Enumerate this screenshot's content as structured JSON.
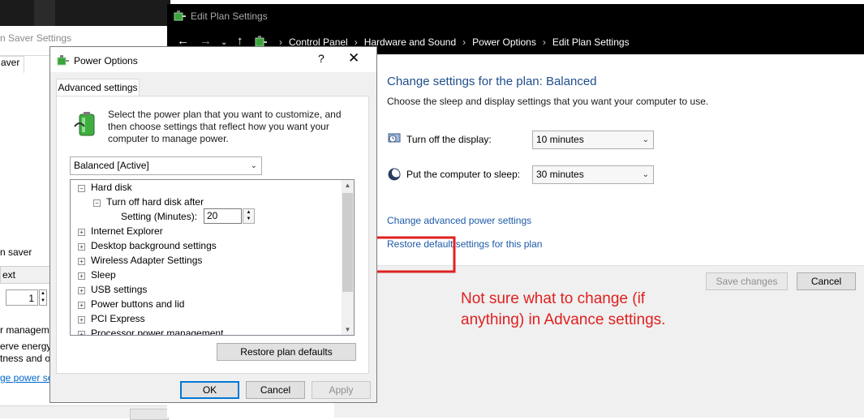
{
  "screen_saver_window": {
    "title_partial": "n Saver Settings",
    "tab_partial": "aver",
    "saver_label_partial": "n saver",
    "text_option_partial": "ext",
    "wait_value": "1",
    "power_mgmt_partial": "r managem",
    "desc_line1_partial": "erve energy",
    "desc_line2_partial": "tness and o",
    "link_partial": "ge power se"
  },
  "edit_plan": {
    "title": "Edit Plan Settings",
    "breadcrumbs": [
      "Control Panel",
      "Hardware and Sound",
      "Power Options",
      "Edit Plan Settings"
    ],
    "heading": "Change settings for the plan: Balanced",
    "subheading": "Choose the sleep and display settings that you want your computer to use.",
    "display_label": "Turn off the display:",
    "display_value": "10 minutes",
    "sleep_label": "Put the computer to sleep:",
    "sleep_value": "30 minutes",
    "advanced_link": "Change advanced power settings",
    "restore_link": "Restore default settings for this plan",
    "save_button": "Save changes",
    "cancel_button": "Cancel"
  },
  "power_options": {
    "title": "Power Options",
    "help_glyph": "?",
    "close_glyph": "✕",
    "tab": "Advanced settings",
    "intro": "Select the power plan that you want to customize, and then choose settings that reflect how you want your computer to manage power.",
    "plan_selected": "Balanced [Active]",
    "tree": {
      "hard_disk": "Hard disk",
      "turn_off_hd": "Turn off hard disk after",
      "setting_label": "Setting (Minutes):",
      "setting_value": "20",
      "items": [
        "Internet Explorer",
        "Desktop background settings",
        "Wireless Adapter Settings",
        "Sleep",
        "USB settings",
        "Power buttons and lid",
        "PCI Express",
        "Processor power management"
      ]
    },
    "restore_button": "Restore plan defaults",
    "ok_button": "OK",
    "cancel_button": "Cancel",
    "apply_button": "Apply"
  },
  "annotation": {
    "text": "Not sure what to change (if anything) in Advance settings.",
    "color": "#e02020"
  }
}
